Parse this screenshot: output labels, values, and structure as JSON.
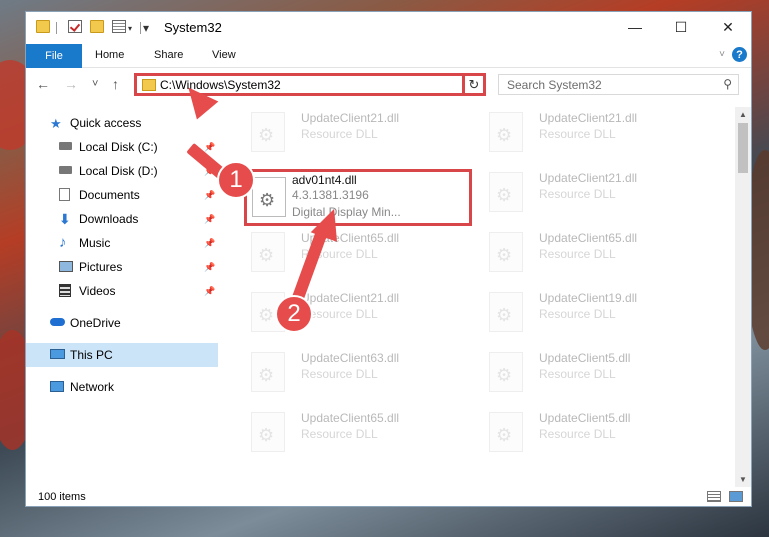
{
  "window": {
    "title": "System32",
    "min": "—",
    "max": "☐",
    "close": "✕"
  },
  "ribbon": {
    "file": "File",
    "home": "Home",
    "share": "Share",
    "view": "View",
    "help": "?"
  },
  "nav": {
    "back": "←",
    "forward": "→",
    "recent": "˅",
    "up": "↑",
    "address": "C:\\Windows\\System32",
    "refresh": "↻",
    "search_placeholder": "Search System32"
  },
  "sidebar": {
    "items": [
      {
        "label": "Quick access"
      },
      {
        "label": "Local Disk (C:)"
      },
      {
        "label": "Local Disk (D:)"
      },
      {
        "label": "Documents"
      },
      {
        "label": "Downloads"
      },
      {
        "label": "Music"
      },
      {
        "label": "Pictures"
      },
      {
        "label": "Videos"
      },
      {
        "label": "OneDrive"
      },
      {
        "label": "This PC"
      },
      {
        "label": "Network"
      }
    ]
  },
  "files": {
    "highlighted": {
      "name": "adv01nt4.dll",
      "version": "4.3.1381.3196",
      "desc": "Digital Display Min..."
    },
    "left": [
      {
        "name": "UpdateClient21.dll",
        "type": "Resource DLL"
      },
      {
        "name": "UpdateClient65.dll",
        "type": "Resource DLL"
      },
      {
        "name": "UpdateClient21.dll",
        "type": "Resource DLL"
      },
      {
        "name": "UpdateClient63.dll",
        "type": "Resource DLL"
      },
      {
        "name": "UpdateClient65.dll",
        "type": "Resource DLL"
      }
    ],
    "right": [
      {
        "name": "UpdateClient21.dll",
        "type": "Resource DLL"
      },
      {
        "name": "UpdateClient21.dll",
        "type": "Resource DLL"
      },
      {
        "name": "UpdateClient65.dll",
        "type": "Resource DLL"
      },
      {
        "name": "UpdateClient19.dll",
        "type": "Resource DLL"
      },
      {
        "name": "UpdateClient5.dll",
        "type": "Resource DLL"
      },
      {
        "name": "UpdateClient5.dll",
        "type": "Resource DLL"
      }
    ]
  },
  "status": {
    "count": "100 items"
  },
  "badges": {
    "one": "1",
    "two": "2"
  },
  "colors": {
    "accent": "#1979ca",
    "highlight": "#d9464a",
    "selected": "#cce4f7"
  }
}
